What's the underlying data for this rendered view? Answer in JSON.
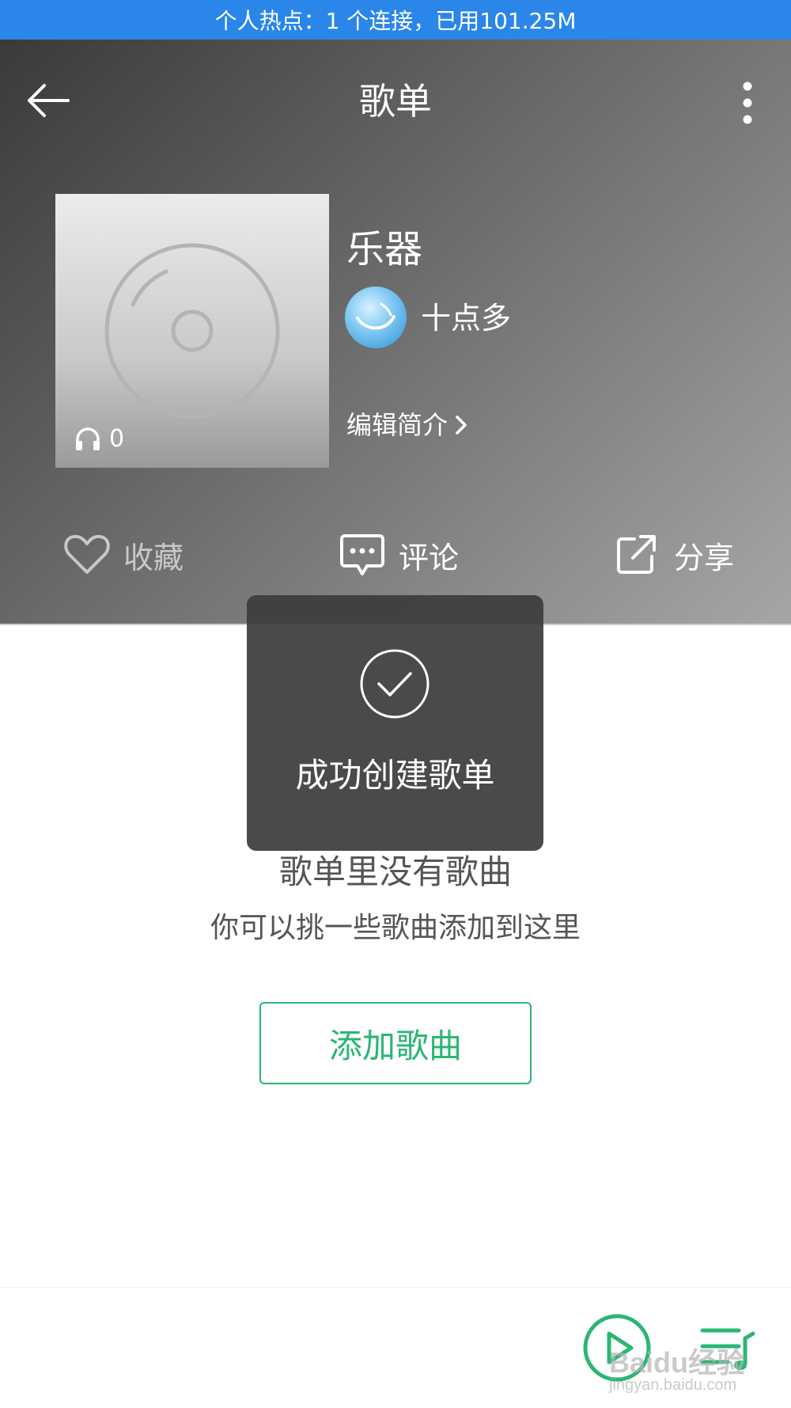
{
  "status_bar": {
    "text": "个人热点：1 个连接，已用101.25M"
  },
  "header": {
    "title": "歌单"
  },
  "playlist": {
    "name": "乐器",
    "play_count": "0",
    "creator": "十点多",
    "edit_intro_label": "编辑简介"
  },
  "actions": {
    "collect": "收藏",
    "comment": "评论",
    "share": "分享"
  },
  "toast": {
    "message": "成功创建歌单"
  },
  "empty_state": {
    "title": "歌单里没有歌曲",
    "description": "你可以挑一些歌曲添加到这里",
    "add_button": "添加歌曲"
  },
  "watermark": {
    "brand": "Baidu经验",
    "url": "jingyan.baidu.com"
  },
  "colors": {
    "status_bar": "#2a86e8",
    "accent_green": "#2bb673",
    "toast_bg": "#3c3c3c"
  }
}
